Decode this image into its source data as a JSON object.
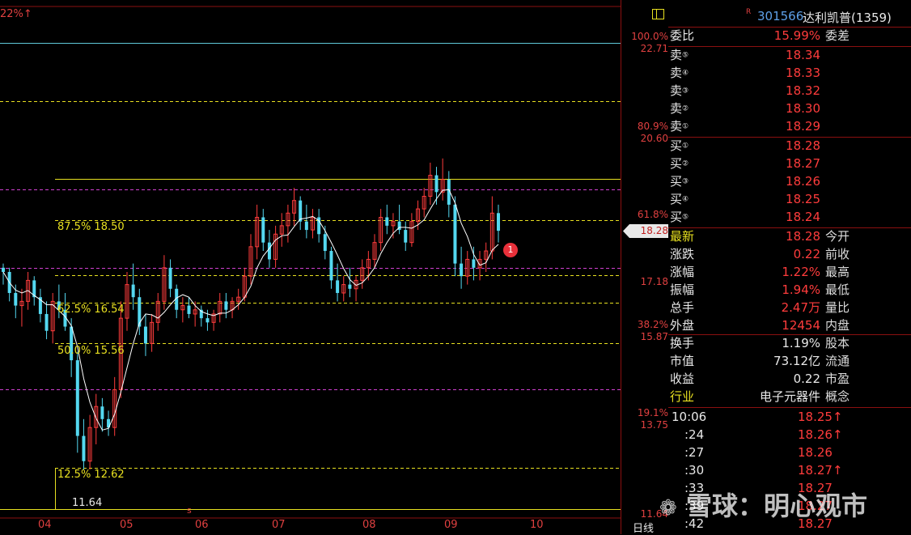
{
  "top_indicator": "22%↑",
  "stock": {
    "code": "301566",
    "name": "达利凯普(1359)",
    "r_mark": "R"
  },
  "weibi": {
    "label": "委比",
    "value": "15.99%",
    "label2": "委差"
  },
  "sell": [
    {
      "label": "卖",
      "num": "⑤",
      "price": "18.34"
    },
    {
      "label": "卖",
      "num": "④",
      "price": "18.33"
    },
    {
      "label": "卖",
      "num": "③",
      "price": "18.32"
    },
    {
      "label": "卖",
      "num": "②",
      "price": "18.30"
    },
    {
      "label": "卖",
      "num": "①",
      "price": "18.29"
    }
  ],
  "buy": [
    {
      "label": "买",
      "num": "①",
      "price": "18.28"
    },
    {
      "label": "买",
      "num": "②",
      "price": "18.27"
    },
    {
      "label": "买",
      "num": "③",
      "price": "18.26"
    },
    {
      "label": "买",
      "num": "④",
      "price": "18.25"
    },
    {
      "label": "买",
      "num": "⑤",
      "price": "18.24"
    }
  ],
  "quote": [
    {
      "label": "最新",
      "value": "18.28",
      "label2": "今开",
      "label_color": "yellow"
    },
    {
      "label": "涨跌",
      "value": "0.22",
      "label2": "前收",
      "label_color": "white"
    },
    {
      "label": "涨幅",
      "value": "1.22%",
      "label2": "最高",
      "label_color": "white"
    },
    {
      "label": "振幅",
      "value": "1.94%",
      "label2": "最低",
      "label_color": "white"
    },
    {
      "label": "总手",
      "value": "2.47万",
      "label2": "量比",
      "label_color": "white"
    },
    {
      "label": "外盘",
      "value": "12454",
      "label2": "内盘",
      "label_color": "white"
    }
  ],
  "info": [
    {
      "label": "换手",
      "value": "1.19%",
      "label2": "股本"
    },
    {
      "label": "市值",
      "value": "73.12亿",
      "label2": "流通"
    },
    {
      "label": "收益",
      "value": "0.22",
      "label2": "市盈"
    },
    {
      "label": "行业",
      "value": "电子元器件",
      "label2": "概念"
    }
  ],
  "ticks": [
    {
      "time": "10:06",
      "price": "18.25↑"
    },
    {
      "time": ":24",
      "price": "18.26↑"
    },
    {
      "time": ":27",
      "price": "18.26"
    },
    {
      "time": ":30",
      "price": "18.27↑"
    },
    {
      "time": ":33",
      "price": "18.27"
    },
    {
      "time": ":39",
      "price": "18.27"
    },
    {
      "time": ":42",
      "price": "18.27"
    }
  ],
  "axis": [
    {
      "pct": "100.0%",
      "price": "22.71"
    },
    {
      "pct": "80.9%",
      "price": "20.60"
    },
    {
      "pct": "61.8%",
      "price": ""
    },
    {
      "pct": "",
      "price": "17.18"
    },
    {
      "pct": "38.2%",
      "price": "15.87"
    },
    {
      "pct": "19.1%",
      "price": "13.75"
    },
    {
      "pct": "",
      "price": "11.64"
    }
  ],
  "current_price_tag": "18.28",
  "fib_labels": [
    "87.5% 18.50",
    "62.5% 16.54",
    "50.0% 15.56",
    "12.5% 12.62"
  ],
  "low_price_label": "11.64",
  "marker_badge": "1",
  "x_labels": [
    "04",
    "05",
    "06",
    "07",
    "08",
    "09",
    "10"
  ],
  "period_label": "日线",
  "watermark": "雪球：明心观市",
  "s_marker": "s",
  "colors": {
    "up": "#ff3c3c",
    "down": "#54d8f0",
    "ma": "#ffffff",
    "fib_yellow": "#e8e020",
    "fib_magenta": "#d040d0",
    "cyan_line": "#5ec8d8"
  },
  "chart_data": {
    "type": "candlestick",
    "ylim": [
      11.64,
      22.71
    ],
    "candles": [
      [
        17.4,
        17.5,
        17.0,
        17.3
      ],
      [
        17.3,
        17.4,
        16.6,
        16.8
      ],
      [
        16.8,
        17.0,
        16.2,
        16.5
      ],
      [
        16.5,
        16.9,
        16.0,
        16.6
      ],
      [
        16.6,
        17.3,
        16.4,
        17.1
      ],
      [
        17.1,
        17.2,
        16.5,
        16.7
      ],
      [
        16.7,
        16.9,
        16.1,
        16.3
      ],
      [
        16.3,
        16.6,
        15.7,
        15.9
      ],
      [
        15.9,
        16.8,
        15.6,
        16.6
      ],
      [
        16.6,
        17.0,
        16.2,
        16.4
      ],
      [
        16.4,
        16.8,
        15.9,
        16.0
      ],
      [
        16.0,
        16.2,
        14.8,
        15.2
      ],
      [
        15.2,
        15.4,
        13.0,
        13.4
      ],
      [
        13.4,
        13.8,
        12.6,
        12.8
      ],
      [
        12.8,
        13.9,
        12.6,
        13.6
      ],
      [
        13.6,
        14.4,
        13.2,
        14.1
      ],
      [
        14.1,
        14.3,
        13.5,
        13.8
      ],
      [
        13.8,
        14.0,
        13.4,
        13.6
      ],
      [
        13.6,
        14.8,
        13.4,
        14.5
      ],
      [
        14.5,
        16.6,
        14.3,
        16.2
      ],
      [
        16.2,
        17.3,
        15.9,
        17.0
      ],
      [
        17.0,
        17.5,
        16.4,
        16.7
      ],
      [
        16.7,
        16.9,
        15.8,
        16.0
      ],
      [
        16.0,
        16.3,
        15.3,
        15.6
      ],
      [
        15.6,
        16.3,
        15.4,
        16.1
      ],
      [
        16.1,
        16.8,
        15.9,
        16.6
      ],
      [
        16.6,
        17.7,
        16.4,
        17.4
      ],
      [
        17.4,
        17.6,
        16.7,
        16.9
      ],
      [
        16.9,
        17.0,
        16.2,
        16.4
      ],
      [
        16.4,
        16.7,
        16.1,
        16.5
      ],
      [
        16.5,
        16.7,
        16.2,
        16.3
      ],
      [
        16.3,
        16.6,
        16.0,
        16.4
      ],
      [
        16.4,
        16.5,
        16.0,
        16.2
      ],
      [
        16.2,
        16.4,
        15.9,
        16.1
      ],
      [
        16.1,
        16.4,
        15.9,
        16.3
      ],
      [
        16.3,
        16.8,
        16.1,
        16.6
      ],
      [
        16.6,
        16.8,
        16.2,
        16.4
      ],
      [
        16.4,
        16.7,
        16.2,
        16.6
      ],
      [
        16.6,
        16.9,
        16.4,
        16.7
      ],
      [
        16.7,
        17.4,
        16.6,
        17.2
      ],
      [
        17.2,
        18.2,
        17.0,
        17.9
      ],
      [
        17.9,
        18.9,
        17.6,
        18.6
      ],
      [
        18.6,
        18.8,
        17.8,
        18.0
      ],
      [
        18.0,
        18.3,
        17.4,
        17.6
      ],
      [
        17.6,
        18.4,
        17.4,
        18.2
      ],
      [
        18.2,
        18.7,
        17.9,
        18.4
      ],
      [
        18.4,
        18.9,
        18.0,
        18.7
      ],
      [
        18.7,
        19.3,
        18.4,
        19.0
      ],
      [
        19.0,
        19.1,
        18.3,
        18.5
      ],
      [
        18.5,
        18.9,
        18.1,
        18.3
      ],
      [
        18.3,
        18.8,
        18.1,
        18.6
      ],
      [
        18.6,
        18.8,
        18.0,
        18.2
      ],
      [
        18.2,
        18.4,
        17.6,
        17.8
      ],
      [
        17.8,
        17.9,
        16.9,
        17.1
      ],
      [
        17.1,
        17.5,
        16.6,
        16.8
      ],
      [
        16.8,
        17.2,
        16.6,
        17.0
      ],
      [
        17.0,
        17.4,
        16.7,
        16.9
      ],
      [
        16.9,
        17.2,
        16.6,
        17.1
      ],
      [
        17.1,
        17.6,
        16.9,
        17.4
      ],
      [
        17.4,
        17.8,
        17.1,
        17.6
      ],
      [
        17.6,
        18.2,
        17.4,
        18.0
      ],
      [
        18.0,
        18.8,
        17.8,
        18.6
      ],
      [
        18.6,
        18.9,
        18.2,
        18.4
      ],
      [
        18.4,
        18.7,
        18.1,
        18.5
      ],
      [
        18.5,
        18.9,
        18.2,
        18.3
      ],
      [
        18.3,
        18.5,
        17.8,
        18.0
      ],
      [
        18.0,
        18.7,
        17.9,
        18.5
      ],
      [
        18.5,
        19.0,
        18.3,
        18.8
      ],
      [
        18.8,
        19.3,
        18.6,
        19.1
      ],
      [
        19.1,
        19.9,
        18.9,
        19.6
      ],
      [
        19.6,
        19.8,
        18.9,
        19.2
      ],
      [
        19.2,
        20.0,
        19.0,
        19.5
      ],
      [
        19.5,
        19.7,
        18.6,
        18.9
      ],
      [
        18.9,
        19.1,
        17.2,
        17.5
      ],
      [
        17.5,
        17.9,
        16.9,
        17.2
      ],
      [
        17.2,
        17.8,
        17.0,
        17.6
      ],
      [
        17.6,
        17.9,
        17.1,
        17.4
      ],
      [
        17.4,
        17.8,
        17.1,
        17.6
      ],
      [
        17.6,
        18.0,
        17.3,
        17.8
      ],
      [
        17.8,
        19.1,
        17.6,
        18.7
      ],
      [
        18.7,
        18.9,
        18.0,
        18.28
      ]
    ]
  }
}
